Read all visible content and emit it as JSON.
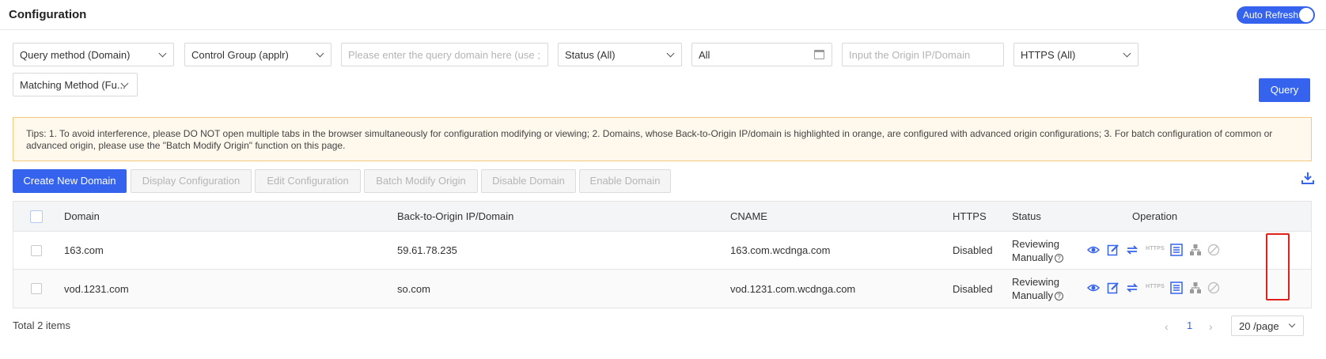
{
  "header": {
    "title": "Configuration",
    "auto_refresh_label": "Auto Refresh"
  },
  "filters": {
    "query_method": "Query method (Domain)",
    "control_group": "Control Group (applr)",
    "domain_placeholder": "Please enter the query domain here (use ; to s",
    "status": "Status (All)",
    "date_range": "All",
    "origin_placeholder": "Input the Origin IP/Domain",
    "https": "HTTPS (All)",
    "matching_method": "Matching Method (Fu...",
    "query_button": "Query"
  },
  "tips": "Tips: 1. To avoid interference, please DO NOT open multiple tabs in the browser simultaneously for configuration modifying or viewing; 2. Domains, whose Back-to-Origin IP/domain is highlighted in orange, are configured with advanced origin configurations; 3. For batch configuration of common or advanced origin, please use the \"Batch Modify Origin\" function on this page.",
  "toolbar": {
    "create": "Create New Domain",
    "display": "Display Configuration",
    "edit": "Edit Configuration",
    "batch": "Batch Modify Origin",
    "disable": "Disable Domain",
    "enable": "Enable Domain"
  },
  "table": {
    "columns": {
      "domain": "Domain",
      "origin": "Back-to-Origin IP/Domain",
      "cname": "CNAME",
      "https": "HTTPS",
      "status": "Status",
      "operation": "Operation"
    },
    "rows": [
      {
        "domain": "163.com",
        "origin": "59.61.78.235",
        "cname": "163.com.wcdnga.com",
        "https": "Disabled",
        "status_line1": "Reviewing",
        "status_line2": "Manually"
      },
      {
        "domain": "vod.1231.com",
        "origin": "so.com",
        "cname": "vod.1231.com.wcdnga.com",
        "https": "Disabled",
        "status_line1": "Reviewing",
        "status_line2": "Manually"
      }
    ],
    "https_tag": "HTTPS"
  },
  "footer": {
    "total": "Total 2 items",
    "page": "1",
    "page_size": "20 /page"
  },
  "colors": {
    "accent": "#3563ee",
    "highlight": "#e0201b",
    "tips_bg": "#fff8ec",
    "tips_border": "#f5c87a"
  }
}
